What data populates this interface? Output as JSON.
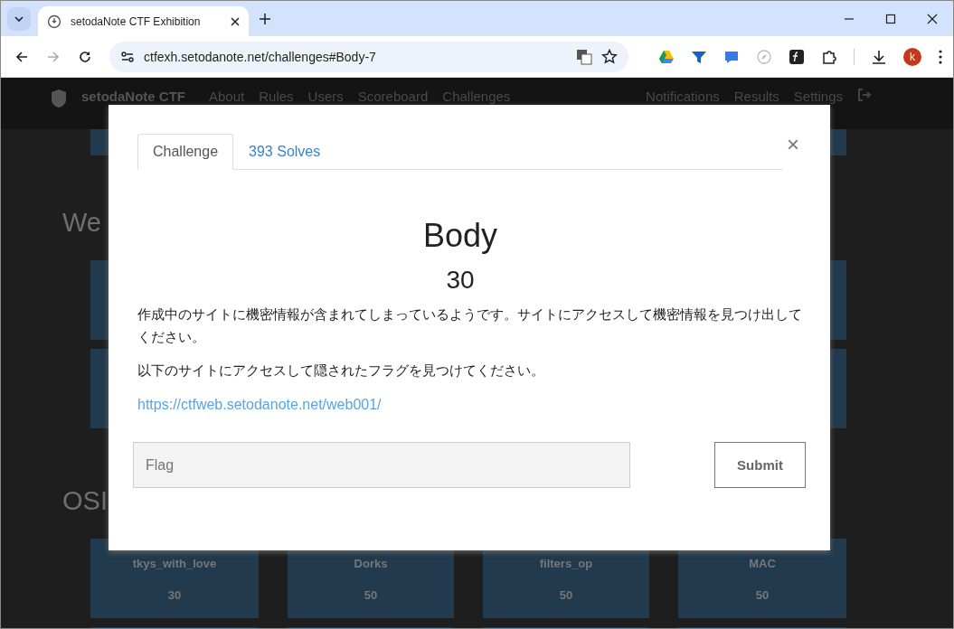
{
  "browser": {
    "tab_title": "setodaNote CTF Exhibition",
    "url": "ctfexh.setodanote.net/challenges#Body-7",
    "profile_initial": "k"
  },
  "navbar": {
    "brand": "setodaNote CTF",
    "links": [
      "About",
      "Rules",
      "Users",
      "Scoreboard",
      "Challenges"
    ],
    "right_links": [
      "Notifications",
      "Results",
      "Settings"
    ]
  },
  "sections": [
    {
      "heading": "We"
    },
    {
      "heading": "OSI"
    }
  ],
  "osint_cards": [
    {
      "name": "tkys_with_love",
      "points": "30"
    },
    {
      "name": "Dorks",
      "points": "50"
    },
    {
      "name": "filters_op",
      "points": "50"
    },
    {
      "name": "MAC",
      "points": "50"
    }
  ],
  "modal": {
    "tabs": [
      {
        "label": "Challenge",
        "selected": true
      },
      {
        "label": "393 Solves",
        "selected": false
      }
    ],
    "close": "×",
    "title": "Body",
    "points": "30",
    "description": [
      "作成中のサイトに機密情報が含まれてしまっているようです。サイトにアクセスして機密情報を見つけ出してください。",
      "以下のサイトにアクセスして隠されたフラグを見つけてください。"
    ],
    "link": "https://ctfweb.setodanote.net/web001/",
    "flag_field": {
      "placeholder": "Flag"
    },
    "submit": "Submit"
  }
}
